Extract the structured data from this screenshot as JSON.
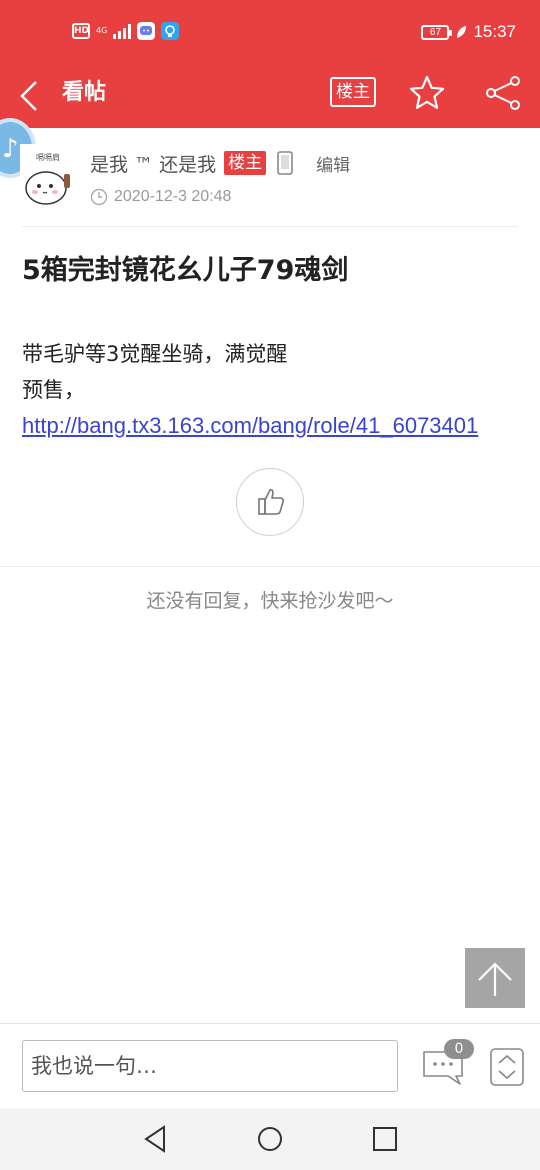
{
  "status_bar": {
    "hd": "HD",
    "network": "4G",
    "battery": "67",
    "time": "15:37"
  },
  "header": {
    "title": "看帖",
    "host_only_label": "楼主"
  },
  "author": {
    "name": "是我 ™ 还是我",
    "host_tag": "楼主",
    "edit_label": "编辑",
    "time": "2020-12-3 20:48"
  },
  "post": {
    "title": "5箱完封镜花幺儿子79魂剑",
    "lines": [
      "带毛驴等3觉醒坐骑，满觉醒",
      "预售，"
    ],
    "link": "http://bang.tx3.163.com/bang/role/41_6073401"
  },
  "replies": {
    "empty_text": "还没有回复，快来抢沙发吧～"
  },
  "bottom_bar": {
    "placeholder": "我也说一句…",
    "comment_count": "0"
  },
  "colors": {
    "brand_red": "#e84040",
    "link_blue": "#3a44d0"
  },
  "icons": [
    "back-icon",
    "star-icon",
    "share-icon",
    "clock-icon",
    "phone-icon",
    "thumbs-up-icon",
    "arrow-up-icon",
    "comment-icon",
    "expand-icon",
    "nav-back-icon",
    "nav-home-icon",
    "nav-recent-icon"
  ]
}
